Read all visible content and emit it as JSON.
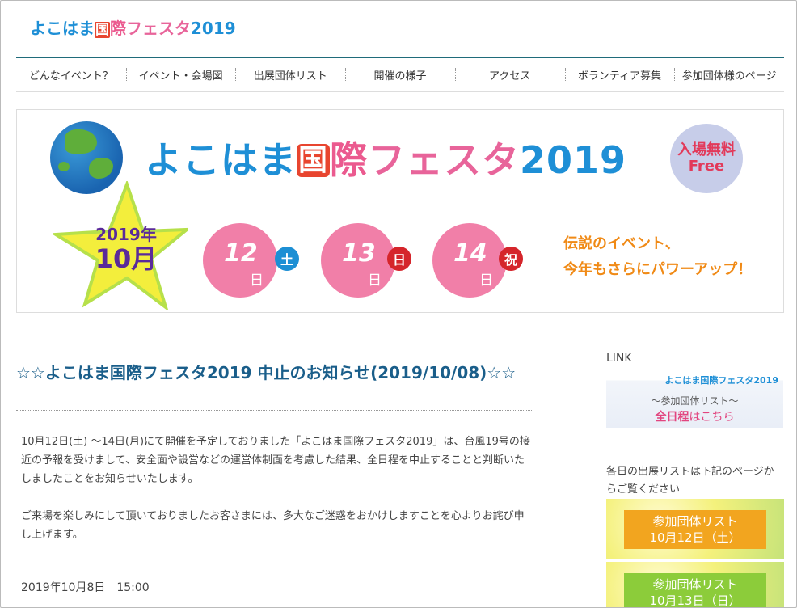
{
  "logo": {
    "part1": "よこはま",
    "part2": "国",
    "part3": "際",
    "part4": "フェスタ",
    "part5": "2019"
  },
  "nav": {
    "items": [
      {
        "label": "どんなイベント？"
      },
      {
        "label": "イベント・会場図"
      },
      {
        "label": "出展団体リスト"
      },
      {
        "label": "開催の様子"
      },
      {
        "label": "アクセス"
      },
      {
        "label": "ボランティア募集"
      },
      {
        "label": "参加団体様のページ"
      }
    ]
  },
  "banner": {
    "title1": "よこはま",
    "title2": "国",
    "title3": "際",
    "title4": "フェスタ",
    "title5": "2019",
    "free_line1": "入場無料",
    "free_line2": "Free",
    "year": "2019年",
    "month": "10月",
    "days": [
      {
        "num": "12",
        "unit": "日",
        "dow": "土"
      },
      {
        "num": "13",
        "unit": "日",
        "dow": "日"
      },
      {
        "num": "14",
        "unit": "日",
        "dow": "祝"
      }
    ],
    "slogan1": "伝説のイベント、",
    "slogan2": "今年もさらにパワーアップ！"
  },
  "article": {
    "title": "☆☆よこはま国際フェスタ2019 中止のお知らせ(2019/10/08)☆☆",
    "para1": "10月12日(土) ～14日(月)にて開催を予定しておりました「よこはま国際フェスタ2019」は、台風19号の接近の予報を受けまして、安全面や設営などの運営体制面を考慮した結果、全日程を中止することと判断いたしましたことをお知らせいたします。",
    "para2": "ご来場を楽しみにして頂いておりましたお客さまには、多大なご迷惑をおかけしますことを心よりお詫び申し上げます。",
    "date": "2019年10月8日　15:00"
  },
  "sidebar": {
    "heading": "LINK",
    "link_banner": {
      "mini_logo": "よこはま国際フェスタ2019",
      "sub": "～参加団体リスト～",
      "all_bold": "全日程",
      "all_rest": "はこちら"
    },
    "text": "各日の出展リストは下記のページからご覧ください",
    "day_banners": [
      {
        "line1": "参加団体リスト",
        "line2": "10月12日（土）"
      },
      {
        "line1": "参加団体リスト",
        "line2": "10月13日（日）"
      }
    ]
  },
  "colors": {
    "nav_border": "#1f6b7a",
    "title_blue": "#1e8fd6",
    "title_pink": "#eb5a8f",
    "article_title": "#1a5e8a",
    "day_circle": "#f17fa8",
    "slogan": "#f08a16"
  }
}
